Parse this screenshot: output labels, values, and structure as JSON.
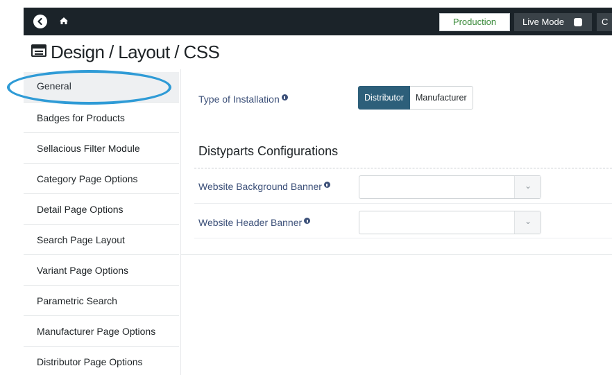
{
  "topbar": {
    "production_label": "Production",
    "live_mode_label": "Live Mode",
    "cut_button_label": "C"
  },
  "page": {
    "title": "Design / Layout / CSS"
  },
  "sidebar": {
    "items": [
      {
        "label": "General",
        "active": true
      },
      {
        "label": "Badges for Products"
      },
      {
        "label": "Sellacious Filter Module"
      },
      {
        "label": "Category Page Options"
      },
      {
        "label": "Detail Page Options"
      },
      {
        "label": "Search Page Layout"
      },
      {
        "label": "Variant Page Options"
      },
      {
        "label": "Parametric Search"
      },
      {
        "label": "Manufacturer Page Options"
      },
      {
        "label": "Distributor Page Options"
      }
    ]
  },
  "general": {
    "installation_label": "Type of Installation",
    "installation_options": [
      "Distributor",
      "Manufacturer"
    ],
    "installation_selected": "Distributor"
  },
  "distyparts": {
    "section_title": "Distyparts Configurations",
    "bg_banner_label": "Website Background Banner",
    "header_banner_label": "Website Header Banner"
  },
  "annotation": {
    "color": "#2f9bd6",
    "target": "General"
  },
  "colors": {
    "topbar": "#1b2329",
    "accent": "#2d5f7a",
    "label": "#3b4f78",
    "production_text": "#3a8a3a"
  }
}
